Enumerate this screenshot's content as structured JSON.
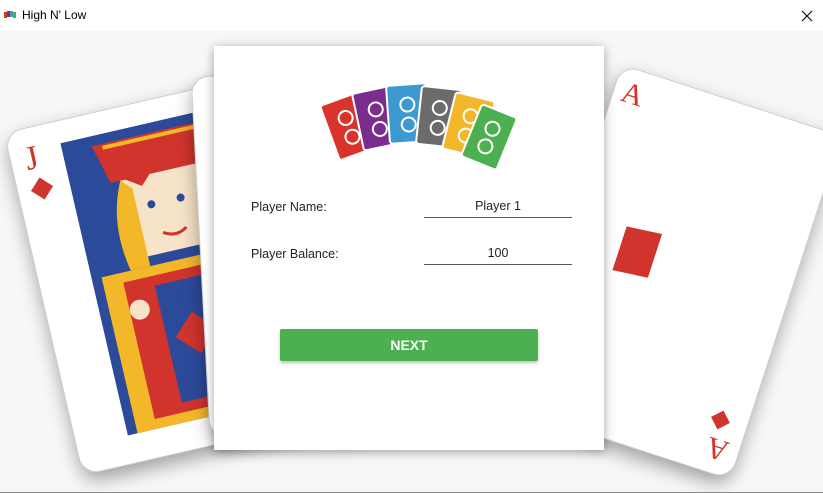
{
  "window": {
    "title": "High N' Low"
  },
  "dialog": {
    "player_name_label": "Player Name:",
    "player_name_value": "Player 1",
    "player_balance_label": "Player Balance:",
    "player_balance_value": "100",
    "next_label": "NEXT"
  },
  "background_cards": {
    "jack_rank": "J",
    "ace_rank": "A"
  },
  "colors": {
    "accent_green": "#4caf50",
    "card_red": "#d0342c",
    "fan_cards": [
      "#d9342b",
      "#7b2d8e",
      "#3d9ad1",
      "#6b6b6b",
      "#f2b82a",
      "#4caf50"
    ]
  }
}
